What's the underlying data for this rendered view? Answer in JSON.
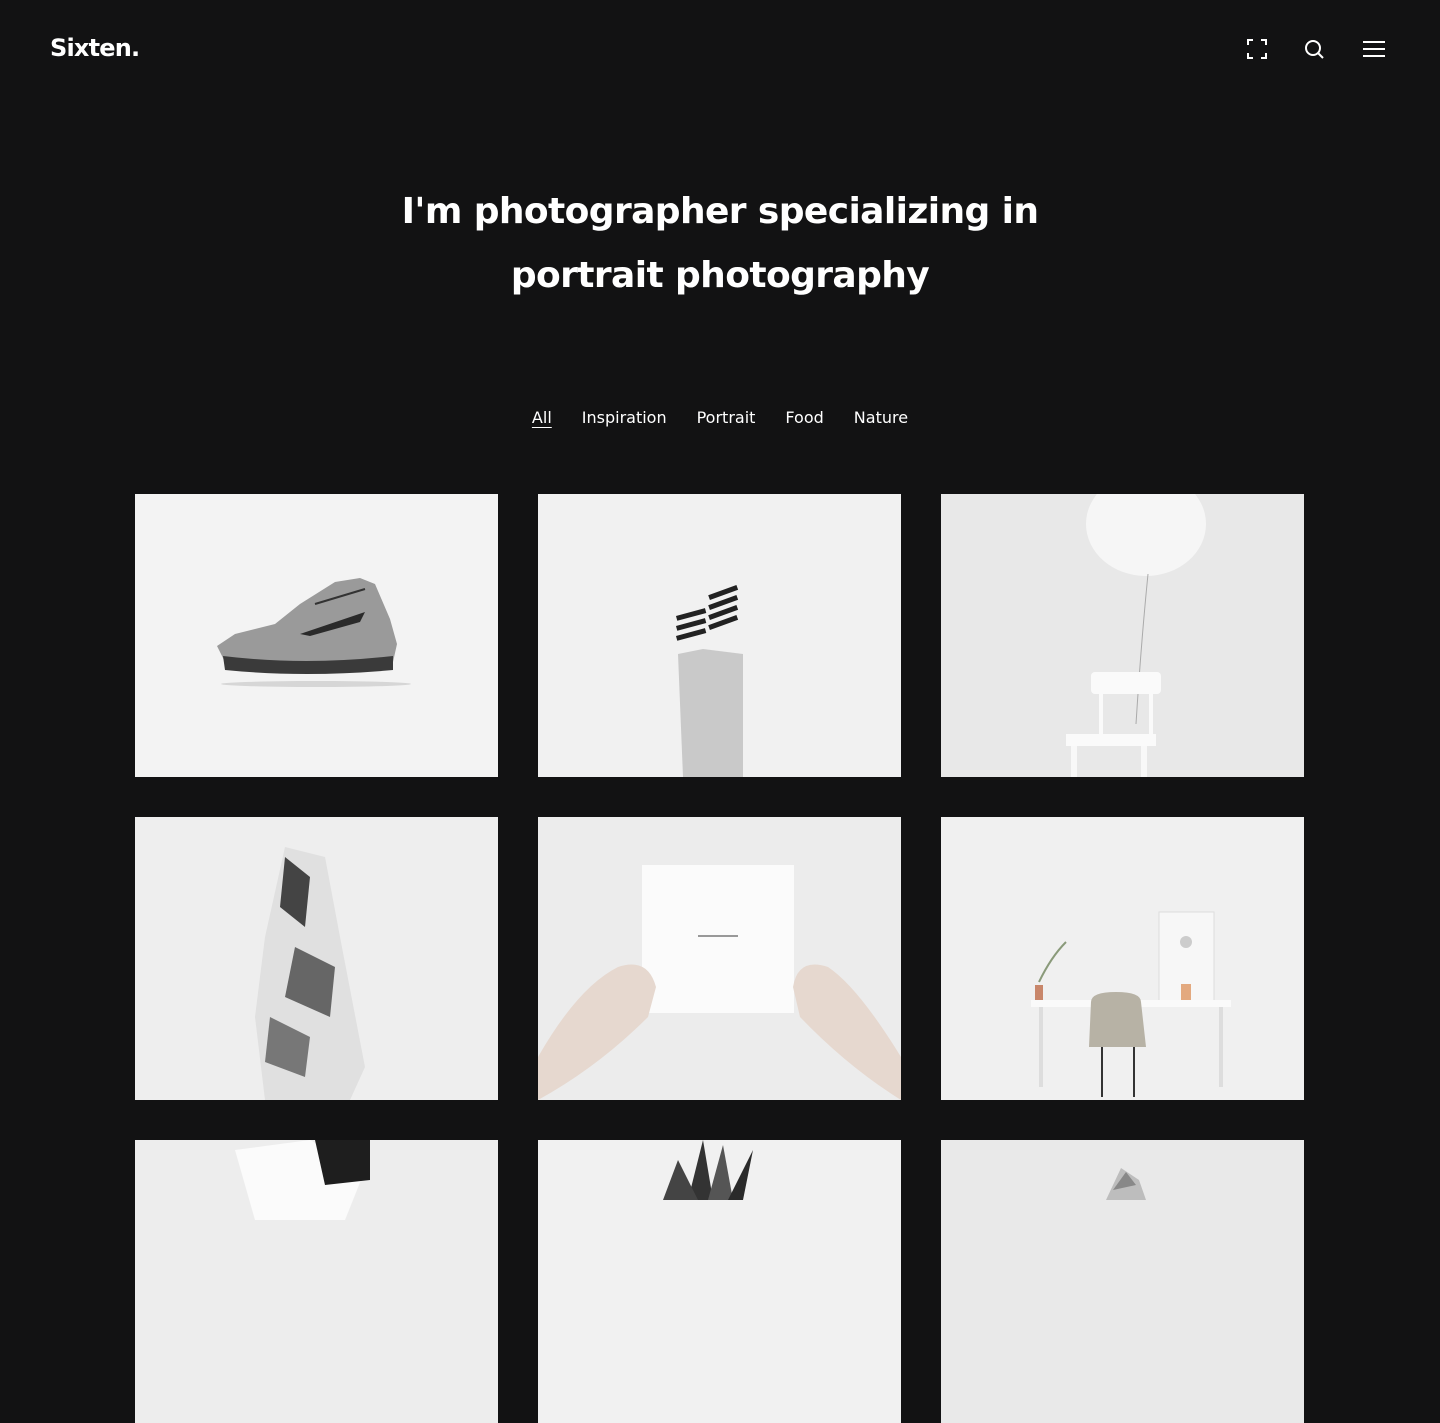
{
  "header": {
    "logo": "Sixten.",
    "icons": [
      "fullscreen-icon",
      "search-icon",
      "menu-icon"
    ]
  },
  "hero": {
    "line1": "I'm photographer specializing in",
    "line2": "portrait photography"
  },
  "filters": [
    {
      "label": "All",
      "active": true
    },
    {
      "label": "Inspiration",
      "active": false
    },
    {
      "label": "Portrait",
      "active": false
    },
    {
      "label": "Food",
      "active": false
    },
    {
      "label": "Nature",
      "active": false
    }
  ],
  "gallery": [
    {
      "subject": "sneaker"
    },
    {
      "subject": "striped-socks-legs"
    },
    {
      "subject": "balloon-chair"
    },
    {
      "subject": "wrapped-figure"
    },
    {
      "subject": "hands-holding-card"
    },
    {
      "subject": "desk-chair-plant"
    },
    {
      "subject": "seated-figure"
    },
    {
      "subject": "pineapple"
    },
    {
      "subject": "sculpture"
    }
  ],
  "colors": {
    "background": "#121213",
    "text": "#ffffff",
    "tile": "#f2f2f2"
  }
}
